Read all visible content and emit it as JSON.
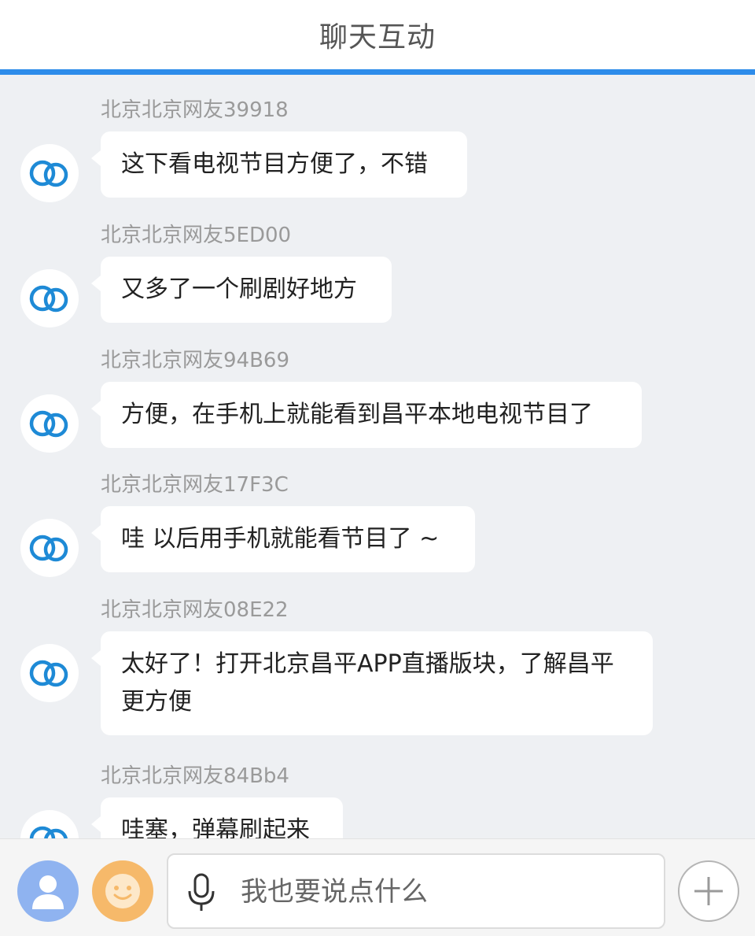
{
  "header": {
    "title": "聊天互动"
  },
  "colors": {
    "accent": "#2d8cea",
    "chat_background": "#eef0f3",
    "bubble": "#ffffff",
    "username": "#9a9a9a"
  },
  "messages": [
    {
      "user": "北京北京网友39918",
      "text": "这下看电视节目方便了，不错",
      "avatar_icon": "cloud-logo-icon"
    },
    {
      "user": "北京北京网友5ED00",
      "text": "又多了一个刷剧好地方",
      "avatar_icon": "cloud-logo-icon"
    },
    {
      "user": "北京北京网友94B69",
      "text": "方便，在手机上就能看到昌平本地电视节目了",
      "avatar_icon": "cloud-logo-icon"
    },
    {
      "user": "北京北京网友17F3C",
      "text": "哇 以后用手机就能看节目了 ~",
      "avatar_icon": "cloud-logo-icon"
    },
    {
      "user": "北京北京网友08E22",
      "text": "太好了！打开北京昌平APP直播版块，了解昌平更方便",
      "avatar_icon": "cloud-logo-icon"
    },
    {
      "user": "北京北京网友84Bb4",
      "text": "哇塞，弹幕刷起来",
      "avatar_icon": "cloud-logo-icon"
    }
  ],
  "footer": {
    "user_icon": "user-avatar-icon",
    "emoji_icon": "smiley-icon",
    "mic_icon": "microphone-icon",
    "input_placeholder": "我也要说点什么",
    "input_value": "",
    "plus_icon": "plus-icon"
  }
}
